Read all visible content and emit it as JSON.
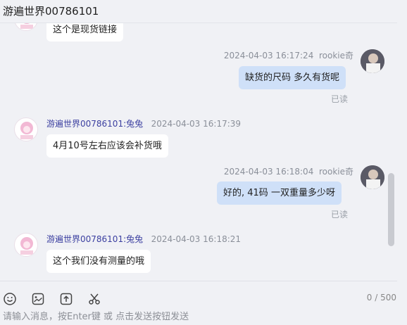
{
  "header": {
    "title": "游遍世界00786101"
  },
  "messages": [
    {
      "side": "left",
      "text": "这个是现货链接"
    },
    {
      "side": "right",
      "time": "2024-04-03 16:17:24",
      "sender": "rookie奇",
      "text": "缺货的尺码  多久有货呢",
      "status": "已读"
    },
    {
      "side": "left",
      "sender": "游遍世界00786101:兔兔",
      "time": "2024-04-03 16:17:39",
      "text": "4月10号左右应该会补货哦"
    },
    {
      "side": "right",
      "time": "2024-04-03 16:18:04",
      "sender": "rookie奇",
      "text": "好的,  41码 一双重量多少呀",
      "status": "已读"
    },
    {
      "side": "left",
      "sender": "游遍世界00786101:兔兔",
      "time": "2024-04-03 16:18:21",
      "text": "这个我们没有测量的哦"
    }
  ],
  "toolbar": {
    "icons": [
      "emoji-icon",
      "image-icon",
      "upload-icon",
      "scissors-icon"
    ],
    "counter": "0 / 500"
  },
  "composer": {
    "placeholder": "请输入消息，按Enter键 或 点击发送按钮发送"
  }
}
